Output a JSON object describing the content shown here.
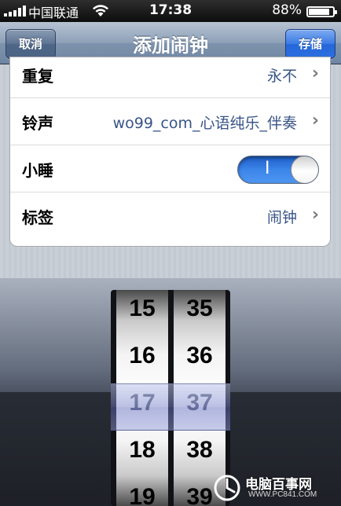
{
  "status_bar": {
    "carrier": "中国联通",
    "time": "17:38",
    "battery_percent": "88%",
    "battery_level": 0.88,
    "signal_bars": 5,
    "wifi_icon": "wifi-icon"
  },
  "nav": {
    "title": "添加闹钟",
    "cancel_label": "取消",
    "save_label": "存储"
  },
  "settings": {
    "repeat": {
      "label": "重复",
      "value": "永不"
    },
    "sound": {
      "label": "铃声",
      "value": "wo99_com_心语纯乐_伴奏"
    },
    "snooze": {
      "label": "小睡",
      "state_label": "I",
      "enabled": true
    },
    "tag": {
      "label": "标签",
      "value": "闹钟"
    }
  },
  "picker": {
    "hours": [
      "15",
      "16",
      "17",
      "18",
      "19"
    ],
    "minutes": [
      "35",
      "36",
      "37",
      "38",
      "39"
    ],
    "selected_hour": "17",
    "selected_minute": "37"
  },
  "watermark": {
    "name": "电脑百事网",
    "url": "WWW.PC841.COM"
  },
  "colors": {
    "nav_bar": "#8ea1b8",
    "save_button": "#2c6fe0",
    "value_text": "#385487",
    "toggle_on": "#3b85ea"
  }
}
